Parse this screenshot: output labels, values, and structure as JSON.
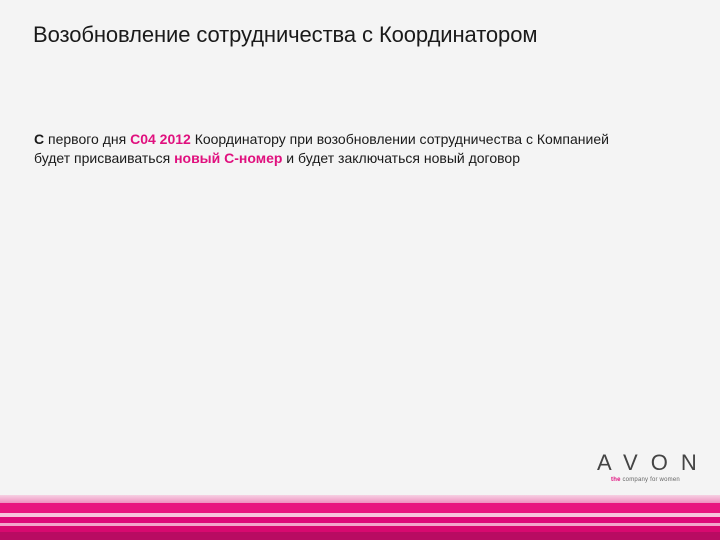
{
  "slide": {
    "title": "Возобновление сотрудничества с Координатором",
    "body": {
      "lead": "С",
      "part1": " первого дня ",
      "highlight1": "С04 2012",
      "part2": " Координатору при возобновлении сотрудничества с Компанией будет присваиваться  ",
      "highlight2": "новый С-номер",
      "part3": " и будет заключаться новый договор"
    },
    "accent_color": "#e0107e"
  },
  "logo": {
    "word": "AVON",
    "tagline_the": "the",
    "tagline_rest": " company for women"
  }
}
